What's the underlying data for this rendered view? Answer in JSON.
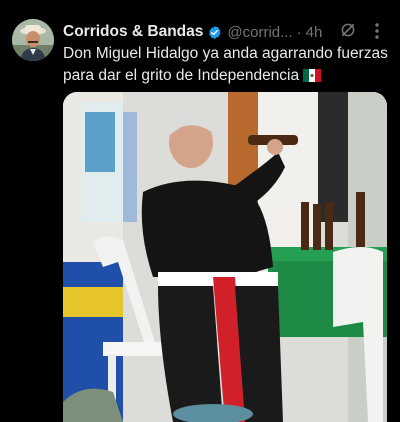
{
  "tweet": {
    "display_name": "Corridos & Bandas",
    "handle": "@corrid...",
    "separator": "·",
    "time": "4h",
    "text": "Don Miguel Hidalgo ya anda agarrando fuerzas para dar el grito de Independencia",
    "text_emoji": "mexico-flag-icon"
  },
  "icons": {
    "verified": "verified-badge-icon",
    "grok": "grok-icon",
    "more": "more-options-icon"
  },
  "colors": {
    "background": "#000000",
    "text_primary": "#e7e9ea",
    "text_secondary": "#71767b",
    "verified_blue": "#1d9bf0"
  }
}
